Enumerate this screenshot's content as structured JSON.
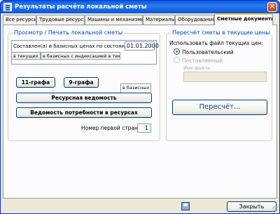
{
  "window": {
    "title": "Результаты расчёта локальной сметы",
    "close_symbol": "×"
  },
  "tabs": [
    {
      "label": "Все ресурсы"
    },
    {
      "label": "Трудовые ресурсы"
    },
    {
      "label": "Машины и механизмы"
    },
    {
      "label": "Материалы"
    },
    {
      "label": "Оборудование"
    },
    {
      "label": "Сметные документы",
      "active": true
    }
  ],
  "left_group": {
    "title": "Просмотр / Печать локальной сметы",
    "composed_label": "Составлен(а) в базисных ценах по состоянию на:",
    "date_value": "01.01.2000",
    "subtabs": [
      {
        "label": "в текущих"
      },
      {
        "label": "в базисных с индексацией в текущие"
      },
      {
        "label": "в базисных",
        "active": true
      }
    ],
    "btn_11": "11-графа",
    "btn_9": "9-графа",
    "btn_resource_statement": "Ресурсная ведомость",
    "btn_resource_demand": "Ведомость потребности в ресурсах",
    "first_page_label": "Номер первой страницы:",
    "first_page_value": "1"
  },
  "right_group": {
    "title": "Пересчёт сметы в текущие цены",
    "use_file_label": "Использовать файл текущих цен:",
    "option_user": "Пользовательский",
    "option_supplied": "Поставляемый",
    "file_name_label": "Имя файла:",
    "recalc_button": "Пересчёт..."
  },
  "footer": {
    "close_button": "Закрыть"
  },
  "colors": {
    "title_bar": "#0a5ddf",
    "group_title": "#0046d5",
    "active_tab_accent": "#ffc73c"
  }
}
